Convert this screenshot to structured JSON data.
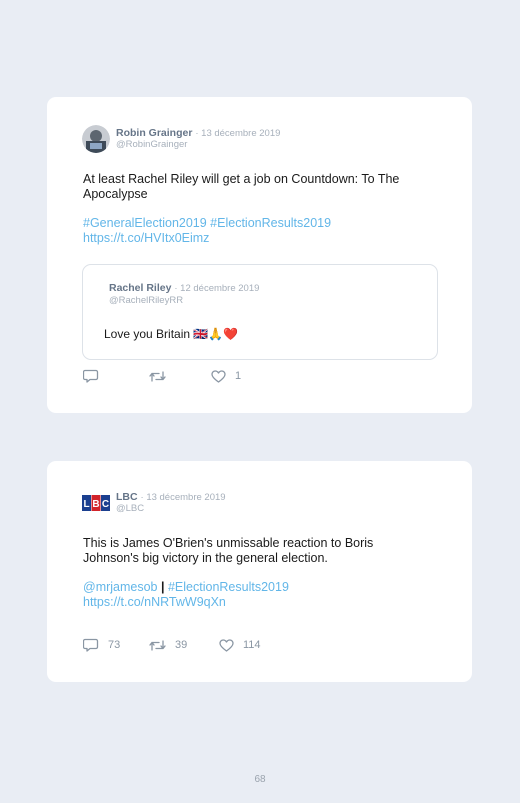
{
  "tweets": [
    {
      "author": "Robin Grainger",
      "date": "· 13 décembre 2019",
      "handle": "@RobinGrainger",
      "text": "At least Rachel Riley will get a job on Countdown: To The Apocalypse",
      "hashtags": "#GeneralElection2019 #ElectionResults2019",
      "url": "https://t.co/HVItx0Eimz",
      "quote": {
        "author": "Rachel Riley",
        "date": "· 12 décembre 2019",
        "handle": "@RachelRileyRR",
        "text": "Love you Britain 🇬🇧🙏❤️"
      },
      "replies": "",
      "retweets": "",
      "likes": "1"
    },
    {
      "author": "LBC",
      "date": "· 13 décembre 2019",
      "handle": "@LBC",
      "text": "This is James O'Brien's unmissable reaction to Boris Johnson's big victory in the general election.",
      "mention": "@mrjamesob",
      "separator": "|",
      "hashtag": "#ElectionResults2019",
      "url": "https://t.co/nNRTwW9qXn",
      "replies": "73",
      "retweets": "39",
      "likes": "114"
    }
  ],
  "page_number": "68",
  "colors": {
    "background": "#e9edf4",
    "link": "#62b6e8",
    "lbc_blue": "#1b3f8f"
  },
  "icons": [
    "reply-icon",
    "retweet-icon",
    "like-icon"
  ]
}
